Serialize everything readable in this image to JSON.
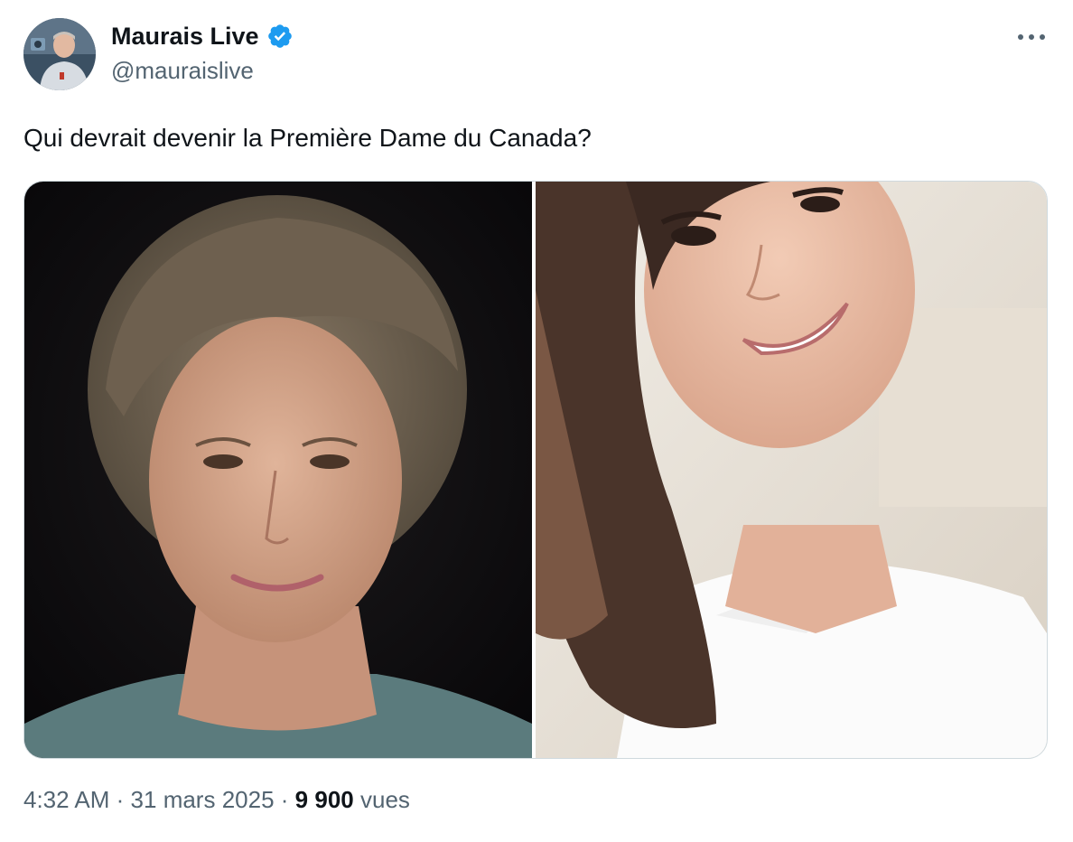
{
  "author": {
    "display_name": "Maurais Live",
    "handle": "@mauraislive",
    "verified": true,
    "verified_badge_color": "#1d9bf0"
  },
  "tweet": {
    "text": "Qui devrait devenir la Première Dame du Canada?",
    "media_count": 2
  },
  "meta": {
    "time": "4:32 AM",
    "separator": "·",
    "date": "31 mars 2025",
    "views_count": "9 900",
    "views_label": "vues"
  },
  "icons": {
    "more": "more-horizontal-icon",
    "verified": "verified-badge-icon"
  },
  "colors": {
    "text_primary": "#0f1419",
    "text_secondary": "#536471",
    "border": "#cfd9de"
  }
}
